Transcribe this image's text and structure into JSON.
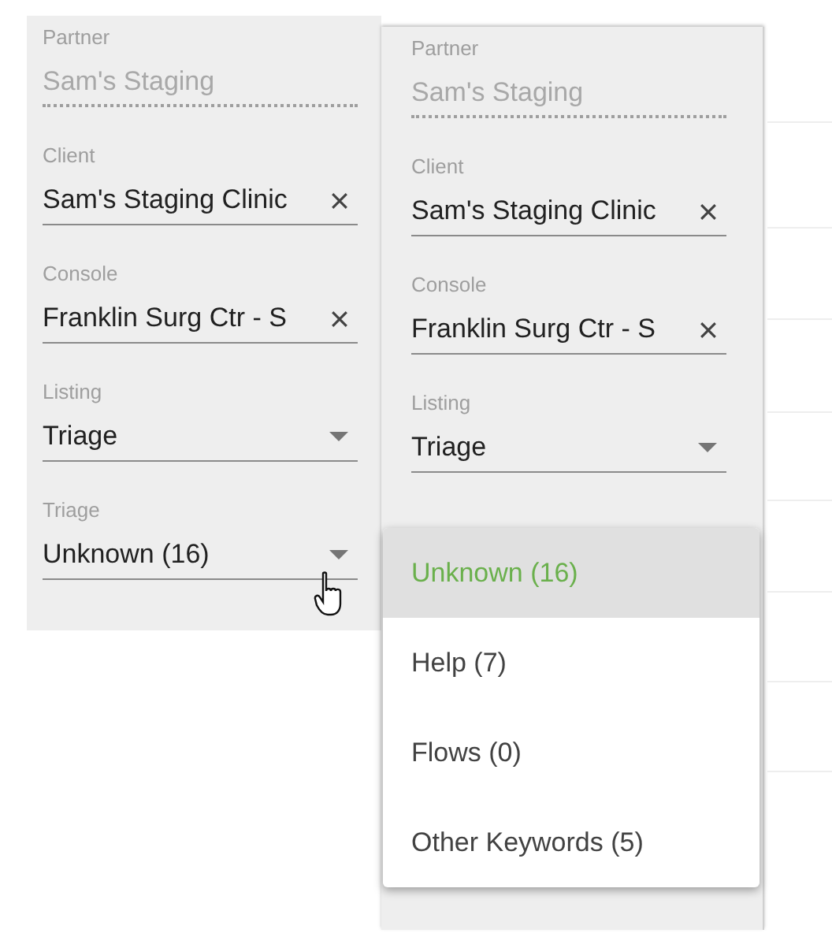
{
  "panels": [
    {
      "fields": [
        {
          "kind": "readonly",
          "label": "Partner",
          "value": "Sam's Staging"
        },
        {
          "kind": "clearable",
          "label": "Client",
          "value": "Sam's Staging Clinic"
        },
        {
          "kind": "clearable",
          "label": "Console",
          "value": "Franklin Surg Ctr - S"
        },
        {
          "kind": "select",
          "label": "Listing",
          "value": "Triage"
        },
        {
          "kind": "select",
          "label": "Triage",
          "value": "Unknown (16)"
        }
      ]
    },
    {
      "fields": [
        {
          "kind": "readonly",
          "label": "Partner",
          "value": "Sam's Staging"
        },
        {
          "kind": "clearable",
          "label": "Client",
          "value": "Sam's Staging Clinic"
        },
        {
          "kind": "clearable",
          "label": "Console",
          "value": "Franklin Surg Ctr - S"
        },
        {
          "kind": "select",
          "label": "Listing",
          "value": "Triage"
        }
      ],
      "menu": [
        {
          "label": "Unknown (16)",
          "selected": true
        },
        {
          "label": "Help (7)",
          "selected": false
        },
        {
          "label": "Flows (0)",
          "selected": false
        },
        {
          "label": "Other Keywords (5)",
          "selected": false
        }
      ]
    }
  ]
}
